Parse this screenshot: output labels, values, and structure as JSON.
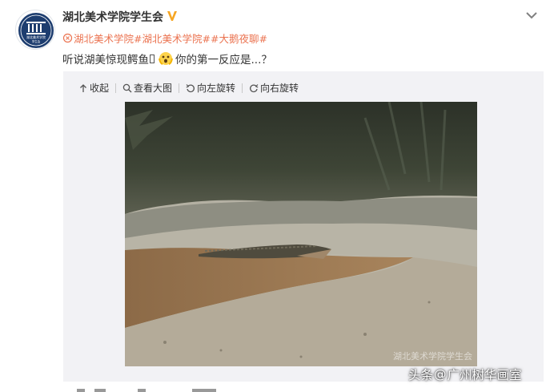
{
  "account": {
    "username": "湖北美术学院学生会",
    "avatar_icon": "hifa-student-union-logo-icon",
    "avatar_text_line1": "湖北美术学院",
    "avatar_text_line2": "学生会",
    "verified_icon": "verified-badge-icon",
    "verified_color": "#f6a623"
  },
  "menu_icon": "chevron-down-icon",
  "post": {
    "topic_icon": "link-icon",
    "tags": [
      "湖北美术学院",
      "#湖北美术学院#",
      "#大鹅夜聊#"
    ],
    "text_before_emoji": "听说湖美惊现鳄鱼",
    "emoji_icon": "shocked-face-emoji-icon",
    "text_after_emoji": "你的第一反应是...？"
  },
  "toolbar": {
    "collapse_label": "收起",
    "view_large_label": "查看大图",
    "rotate_left_label": "向左旋转",
    "rotate_right_label": "向右旋转"
  },
  "photo": {
    "subject": "crocodile-on-mudflat",
    "watermark": "湖北美术学院学生会"
  },
  "watermark": {
    "brand": "头条",
    "at": "@",
    "author": "广州树华画室"
  },
  "colors": {
    "link": "#eb7350",
    "text": "#333333",
    "media_bg": "#f2f2f5"
  }
}
